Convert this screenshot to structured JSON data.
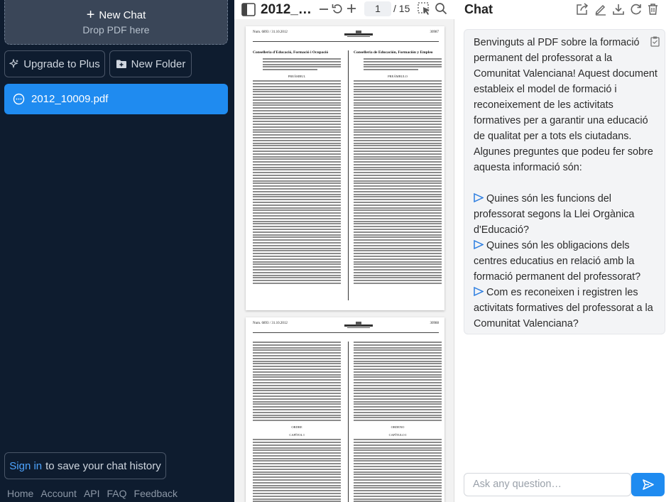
{
  "sidebar": {
    "new_chat": "New Chat",
    "drop_pdf": "Drop PDF here",
    "upgrade": "Upgrade to Plus",
    "new_folder": "New Folder",
    "files": [
      {
        "name": "2012_10009.pdf"
      }
    ],
    "sign_in_link": "Sign in",
    "sign_in_rest": "to save your chat history",
    "footer": [
      "Home",
      "Account",
      "API",
      "FAQ",
      "Feedback"
    ]
  },
  "pdf": {
    "title": "2012_…",
    "page_current": "1",
    "page_total": "/ 15",
    "page1": {
      "num_left": "Num. 6893 / 31.10.2012",
      "num_right": "30987",
      "left_heading": "Conselleria d'Educació, Formació i Ocupació",
      "right_heading": "Conselleria de Educación, Formación y Empleo",
      "left_center": "PREÀMBUL",
      "right_center": "PREÁMBULO"
    },
    "page2": {
      "num_left": "Num. 6893 / 31.10.2012",
      "num_right": "30988",
      "left_center": "ORDRE",
      "right_center": "ORDENO",
      "left_chapter": "CAPÍTOL I",
      "right_chapter": "CAPÍTULO I"
    }
  },
  "chat": {
    "title": "Chat",
    "intro": "Benvinguts al PDF sobre la formació permanent del professorat a la Comunitat Valenciana! Aquest document estableix el model de formació i reconeixement de les activitats formatives per a garantir una educació de qualitat per a tots els ciutadans. Algunes preguntes que podeu fer sobre aquesta informació són:",
    "questions": [
      "Quines són les funcions del professorat segons la Llei Orgànica d'Educació?",
      "Quines són les obligacions dels centres educatius en relació amb la formació permanent del professorat?",
      "Com es reconeixen i registren les activitats formatives del professorat a la Comunitat Valenciana?"
    ],
    "input_placeholder": "Ask any question…"
  },
  "colors": {
    "sidebar_bg": "#0e1c2f",
    "accent": "#1f8bf0"
  }
}
